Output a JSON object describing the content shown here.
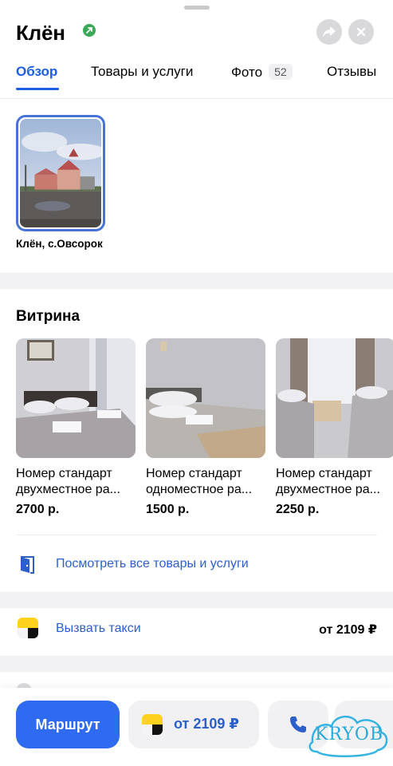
{
  "place": {
    "name": "Клён"
  },
  "tabs": [
    {
      "label": "Обзор",
      "active": true
    },
    {
      "label": "Товары и услуги"
    },
    {
      "label": "Фото",
      "badge": "52"
    },
    {
      "label": "Отзывы"
    }
  ],
  "gallery": {
    "caption": "Клён, с.Овсорок"
  },
  "showcase": {
    "title": "Витрина",
    "items": [
      {
        "title": "Номер стандарт двухместное ра...",
        "price": "2700 р."
      },
      {
        "title": "Номер стандарт одноместное ра...",
        "price": "1500 р."
      },
      {
        "title": "Номер стандарт двухместное ра...",
        "price": "2250 р."
      }
    ],
    "view_all_label": "Посмотреть все товары и услуги"
  },
  "taxi": {
    "label": "Вызвать такси",
    "price": "от 2109 ₽"
  },
  "bottom_bar": {
    "route_label": "Маршрут",
    "taxi_price": "от 2109 ₽"
  },
  "watermark": {
    "text": "KRYOB"
  },
  "colors": {
    "accent": "#1a5fe5",
    "link": "#2c5fc9",
    "route_button": "#2f6bf0",
    "verified": "#3aa856",
    "taxi_yellow": "#ffd21e"
  }
}
